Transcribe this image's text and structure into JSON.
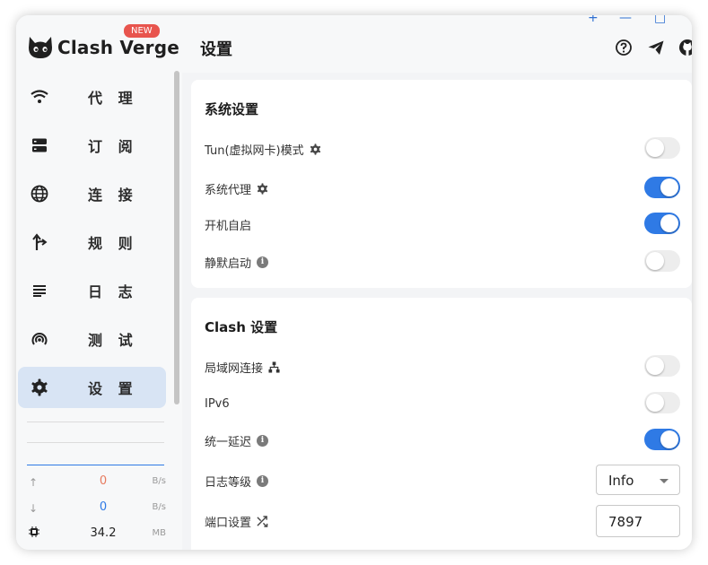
{
  "app": {
    "name": "Clash Verge",
    "badge": "NEW"
  },
  "sidebar": {
    "items": [
      {
        "label": "代 理",
        "icon": "wifi-icon"
      },
      {
        "label": "订 阅",
        "icon": "storage-icon"
      },
      {
        "label": "连 接",
        "icon": "globe-icon"
      },
      {
        "label": "规 则",
        "icon": "fork-icon"
      },
      {
        "label": "日 志",
        "icon": "notes-icon"
      },
      {
        "label": "测 试",
        "icon": "radar-icon"
      },
      {
        "label": "设 置",
        "icon": "gear-icon",
        "active": true
      }
    ],
    "traffic": {
      "upload": {
        "value": "0",
        "unit": "B/s",
        "color": "#e77a5e"
      },
      "download": {
        "value": "0",
        "unit": "B/s",
        "color": "#2f7ae5"
      },
      "memory": {
        "value": "34.2",
        "unit": "MB"
      }
    }
  },
  "header": {
    "title": "设置",
    "window_controls": [
      "+",
      "—",
      "□"
    ],
    "icons": [
      "help-icon",
      "telegram-icon",
      "github-icon"
    ]
  },
  "system_settings": {
    "title": "系统设置",
    "rows": [
      {
        "label": "Tun(虚拟网卡)模式",
        "icon": "gear-icon",
        "enabled": false
      },
      {
        "label": "系统代理",
        "icon": "gear-icon",
        "enabled": true
      },
      {
        "label": "开机自启",
        "enabled": true
      },
      {
        "label": "静默启动",
        "icon": "info-icon",
        "enabled": false
      }
    ]
  },
  "clash_settings": {
    "title": "Clash 设置",
    "rows": [
      {
        "label": "局域网连接",
        "icon": "lan-icon",
        "enabled": false
      },
      {
        "label": "IPv6",
        "enabled": false
      },
      {
        "label": "统一延迟",
        "icon": "info-icon",
        "enabled": true
      },
      {
        "label": "日志等级",
        "icon": "info-icon",
        "value": "Info"
      },
      {
        "label": "端口设置",
        "icon": "shuffle-icon",
        "value": "7897"
      }
    ]
  },
  "colors": {
    "accent": "#2f7ae5",
    "active_bg": "#d8e4f4",
    "badge": "#e8554e"
  }
}
